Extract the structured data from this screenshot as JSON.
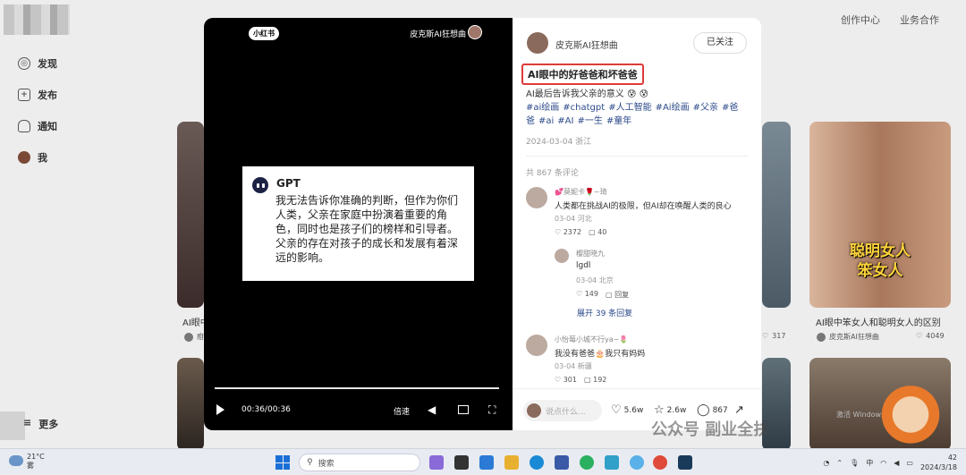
{
  "topnav": {
    "creator": "创作中心",
    "business": "业务合作"
  },
  "sidebar": {
    "items": [
      {
        "label": "发现",
        "icon": "discover-icon"
      },
      {
        "label": "发布",
        "icon": "plus-icon"
      },
      {
        "label": "通知",
        "icon": "bell-icon"
      },
      {
        "label": "我",
        "icon": "avatar"
      }
    ],
    "more": "更多"
  },
  "feed": {
    "left_title": "AI眼中",
    "left_author": "疳",
    "right_title": "AI眼中笨女人和聪明女人的区别",
    "right_author": "皮克斯AI狂想曲",
    "right_likes": "4049",
    "mid_likes": "317",
    "right_overlay": [
      "聪明女人",
      "笨女人"
    ]
  },
  "video": {
    "badge": "小红书",
    "author": "皮克斯AI狂想曲",
    "gpt_name": "GPT",
    "gpt_text": "我无法告诉你准确的判断，但作为你们人类，父亲在家庭中扮演着重要的角色，同时也是孩子们的榜样和引导者。父亲的存在对孩子的成长和发展有着深远的影响。",
    "time": "00:36/00:36",
    "speed": "倍速",
    "progress": 1.0
  },
  "note": {
    "author": "皮克斯AI狂想曲",
    "follow": "已关注",
    "title": "AI眼中的好爸爸和坏爸爸",
    "desc": "AI最后告诉我父亲的意义 😰 😰",
    "tags": [
      "#ai绘画",
      "#chatgpt",
      "#人工智能",
      "#Ai绘画",
      "#父亲",
      "#爸爸",
      "#ai",
      "#AI",
      "#一生",
      "#童年"
    ],
    "date": "2024-03-04 浙江",
    "comment_count": "共 867 条评论"
  },
  "comments": [
    {
      "name": "💕莫妮卡🌹~琦",
      "text": "人类都在挑战AI的极限，但AI却在唤醒人类的良心",
      "meta": "03-04 河北",
      "likes": "2372",
      "replies": "40"
    },
    {
      "name": "樱甜晓九",
      "text": "lgdl",
      "meta": "03-04 北京",
      "likes": "149",
      "replies": "回复"
    },
    {
      "name": "小怡莓小城不行ya~🌷",
      "text": "我没有爸爸🎂我只有妈妈",
      "meta": "03-04 新疆",
      "likes": "301",
      "replies": "192"
    }
  ],
  "expand_replies": "展开 39 条回复",
  "bottom": {
    "placeholder": "说点什么...",
    "likes": "5.6w",
    "collects": "2.6w",
    "comments": "867"
  },
  "watermark": "公众号 副业全扶",
  "windows_watermark": "激活 Windows",
  "taskbar": {
    "temp": "21°C",
    "weather": "雾",
    "search": "搜索",
    "ime": "中",
    "time": "42",
    "date": "2024/3/18"
  },
  "colors": {
    "title_highlight": "#e03a3a",
    "tag": "#2c4a8a"
  }
}
